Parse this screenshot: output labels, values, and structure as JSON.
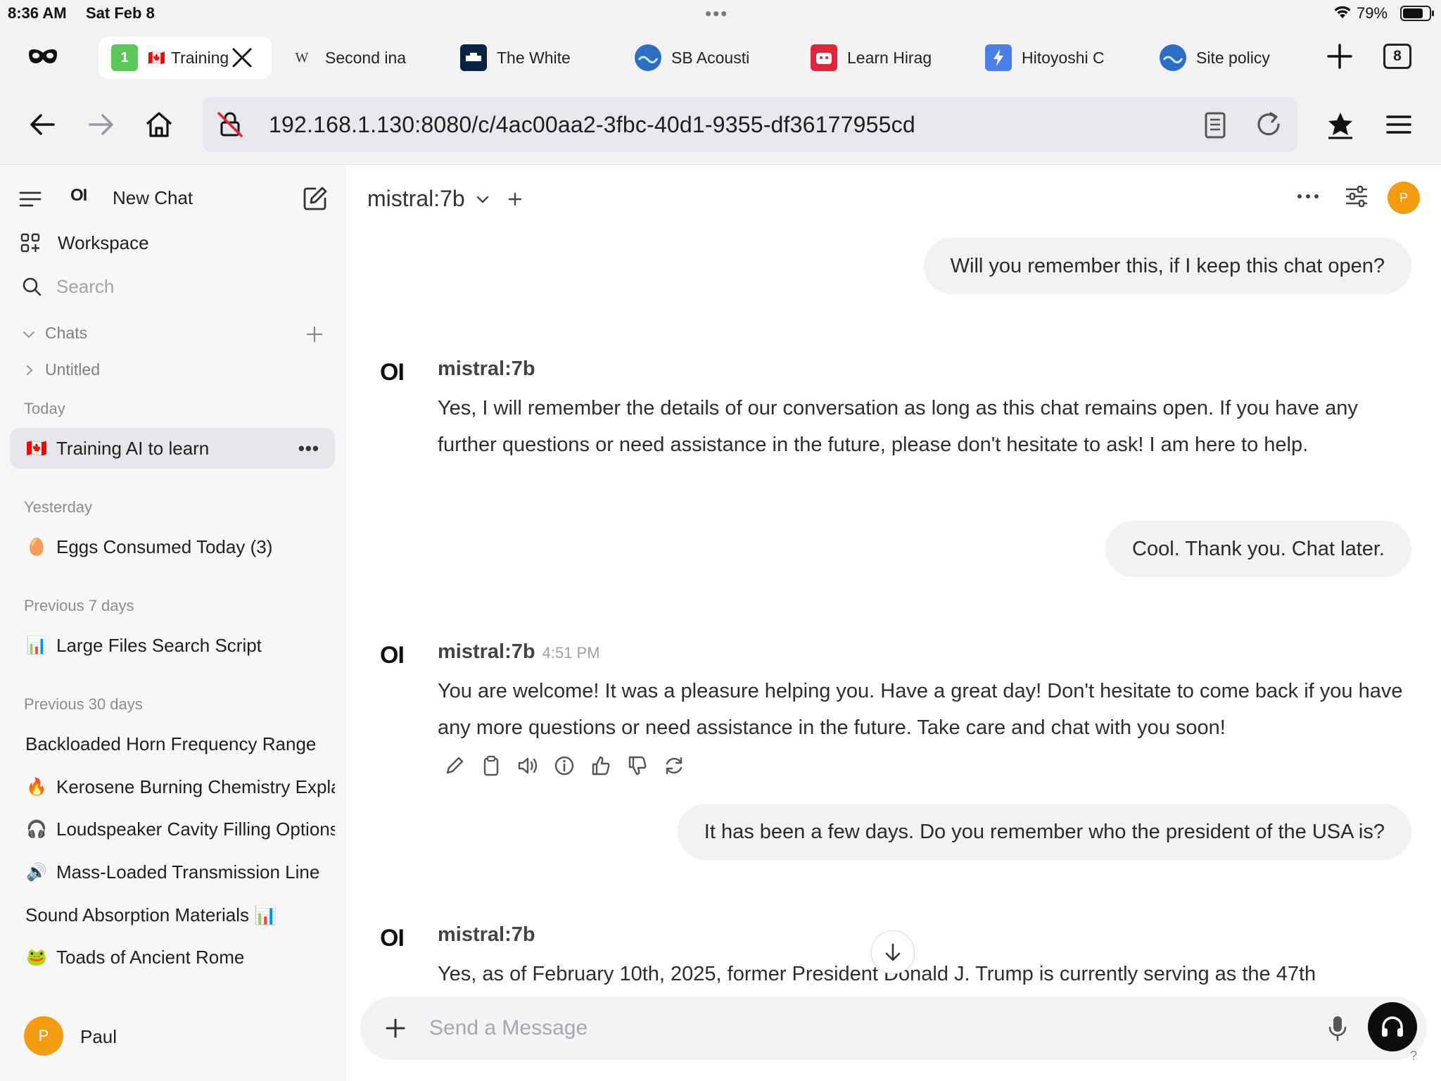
{
  "status_bar": {
    "time": "8:36 AM",
    "date": "Sat Feb 8",
    "battery_percent": "79%",
    "battery_level": 0.79
  },
  "tabs": [
    {
      "label": "Training",
      "favicon": "1",
      "flag": "🇨🇦",
      "active": true
    },
    {
      "label": "Second ina",
      "favicon": "W"
    },
    {
      "label": "The White",
      "favicon": "white-house"
    },
    {
      "label": "SB Acousti",
      "favicon": "wave-globe"
    },
    {
      "label": "Learn Hirag",
      "favicon": "red-face"
    },
    {
      "label": "Hitoyoshi C",
      "favicon": "bolt"
    },
    {
      "label": "Site policy",
      "favicon": "wave-globe"
    }
  ],
  "tab_count": "8",
  "address_bar": {
    "url": "192.168.1.130:8080/c/4ac00aa2-3fbc-40d1-9355-df36177955cd"
  },
  "sidebar": {
    "logo": "OI",
    "new_chat": "New Chat",
    "workspace": "Workspace",
    "search_placeholder": "Search",
    "chats_header": "Chats",
    "untitled_folder": "Untitled",
    "sections": {
      "today": "Today",
      "yesterday": "Yesterday",
      "prev7": "Previous 7 days",
      "prev30": "Previous 30 days"
    },
    "items": [
      {
        "emoji": "🇨🇦",
        "label": "Training AI to learn"
      },
      {
        "emoji": "🥚",
        "label": "Eggs Consumed Today (3)"
      },
      {
        "emoji": "📊",
        "label": "Large Files Search Script"
      },
      {
        "emoji": "",
        "label": "Backloaded Horn Frequency Range"
      },
      {
        "emoji": "🔥",
        "label": "Kerosene Burning Chemistry Explained"
      },
      {
        "emoji": "🎧",
        "label": "Loudspeaker Cavity Filling Options"
      },
      {
        "emoji": "🔊",
        "label": "Mass-Loaded Transmission Line"
      },
      {
        "emoji": "",
        "label": "Sound Absorption Materials 📊"
      },
      {
        "emoji": "🐸",
        "label": "Toads of Ancient Rome"
      }
    ],
    "user": {
      "initial": "P",
      "name": "Paul"
    }
  },
  "chat": {
    "model": "mistral:7b",
    "avatar_initial": "P",
    "ai_logo": "OI",
    "messages": [
      {
        "role": "user",
        "text": "Will you remember this, if I keep this chat open?"
      },
      {
        "role": "assistant",
        "name": "mistral:7b",
        "time": "",
        "text": "Yes, I will remember the details of our conversation as long as this chat remains open. If you have any further questions or need assistance in the future, please don't hesitate to ask! I am here to help."
      },
      {
        "role": "user",
        "text": "Cool. Thank you. Chat later."
      },
      {
        "role": "assistant",
        "name": "mistral:7b",
        "time": "4:51 PM",
        "text": "You are welcome! It was a pleasure helping you. Have a great day! Don't hesitate to come back if you have any more questions or need assistance in the future. Take care and chat with you soon!"
      },
      {
        "role": "user",
        "text": "It has been a few days. Do you remember who the president of the USA is?"
      },
      {
        "role": "assistant",
        "name": "mistral:7b",
        "time": "",
        "text": "Yes, as of February 10th, 2025, former President Donald J. Trump is currently serving as the 47th"
      }
    ],
    "composer_placeholder": "Send a Message",
    "help": "?"
  },
  "colors": {
    "avatar": "#f39c12",
    "active_item": "#e6e6ea",
    "bubble": "#f2f2f4"
  }
}
